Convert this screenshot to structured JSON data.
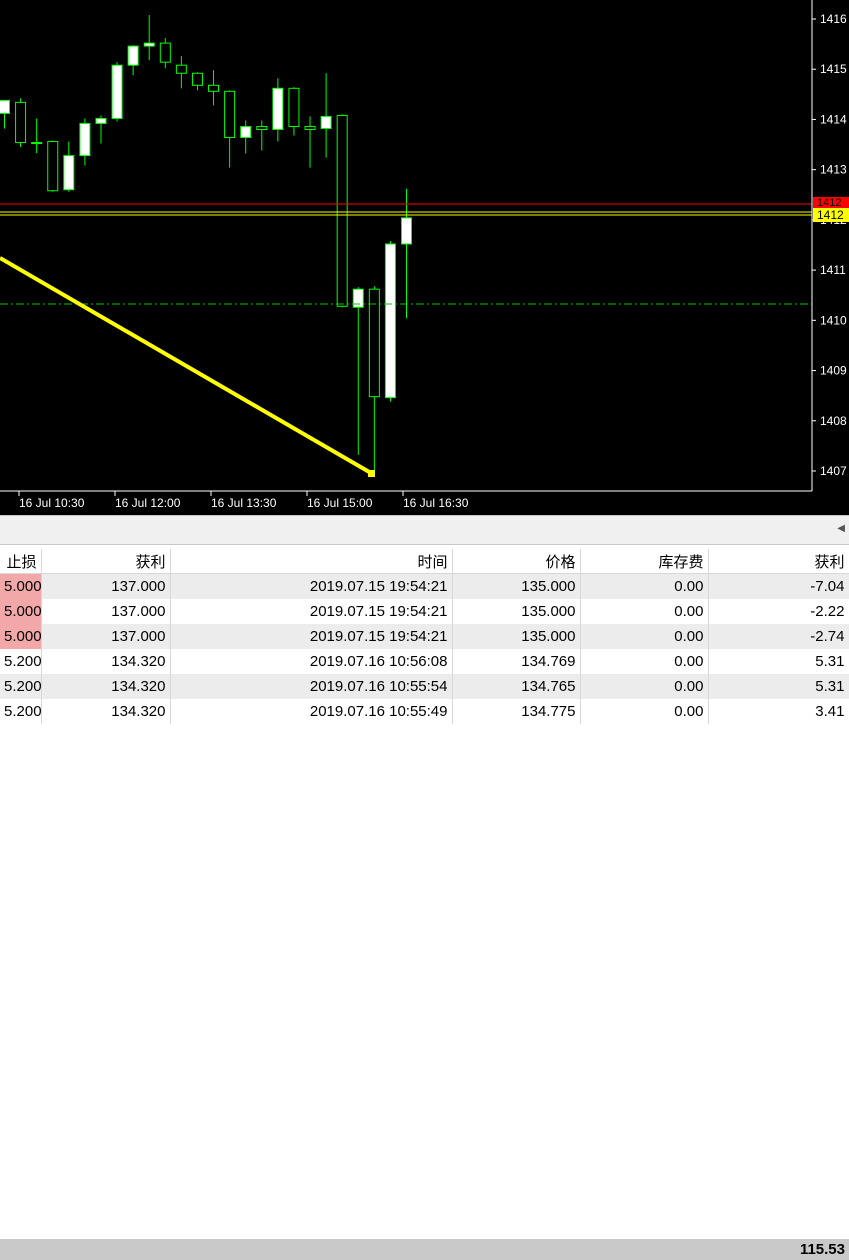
{
  "chart": {
    "price_labels": [
      "1416",
      "1415",
      "1414",
      "1413",
      "1412",
      "1411",
      "1410",
      "1409",
      "1408",
      "1407"
    ],
    "time_labels": [
      "16 Jul 10:30",
      "16 Jul 12:00",
      "16 Jul 13:30",
      "16 Jul 15:00",
      "16 Jul 16:30"
    ],
    "ask_label": "1412",
    "bid_label": "1412",
    "colors": {
      "background": "#000000",
      "candle": "#00ff00",
      "bull_body": "#ffffff",
      "bear_body": "#000000",
      "ask_line": "#ff0000",
      "bid_line": "#ffff00",
      "trend_line": "#ffff00",
      "level_line": "#00c800"
    },
    "candles": [
      {
        "o": 1414.12,
        "h": 1414.38,
        "l": 1413.82,
        "c": 1414.38
      },
      {
        "o": 1414.34,
        "h": 1414.42,
        "l": 1413.45,
        "c": 1413.54
      },
      {
        "o": 1413.54,
        "h": 1414.02,
        "l": 1413.33,
        "c": 1413.54
      },
      {
        "o": 1413.56,
        "h": 1413.58,
        "l": 1412.56,
        "c": 1412.58
      },
      {
        "o": 1412.6,
        "h": 1413.56,
        "l": 1412.56,
        "c": 1413.28
      },
      {
        "o": 1413.28,
        "h": 1414.02,
        "l": 1413.08,
        "c": 1413.92
      },
      {
        "o": 1413.92,
        "h": 1414.08,
        "l": 1413.52,
        "c": 1414.02
      },
      {
        "o": 1414.02,
        "h": 1415.14,
        "l": 1413.96,
        "c": 1415.08
      },
      {
        "o": 1415.08,
        "h": 1415.48,
        "l": 1414.88,
        "c": 1415.46
      },
      {
        "o": 1415.46,
        "h": 1416.08,
        "l": 1415.18,
        "c": 1415.52
      },
      {
        "o": 1415.52,
        "h": 1415.62,
        "l": 1415.02,
        "c": 1415.14
      },
      {
        "o": 1415.08,
        "h": 1415.26,
        "l": 1414.62,
        "c": 1414.92
      },
      {
        "o": 1414.92,
        "h": 1414.94,
        "l": 1414.58,
        "c": 1414.68
      },
      {
        "o": 1414.68,
        "h": 1414.98,
        "l": 1414.28,
        "c": 1414.56
      },
      {
        "o": 1414.56,
        "h": 1414.58,
        "l": 1413.04,
        "c": 1413.64
      },
      {
        "o": 1413.64,
        "h": 1413.98,
        "l": 1413.32,
        "c": 1413.86
      },
      {
        "o": 1413.86,
        "h": 1413.98,
        "l": 1413.38,
        "c": 1413.8
      },
      {
        "o": 1413.8,
        "h": 1414.82,
        "l": 1413.56,
        "c": 1414.62
      },
      {
        "o": 1414.62,
        "h": 1414.64,
        "l": 1413.68,
        "c": 1413.86
      },
      {
        "o": 1413.86,
        "h": 1414.06,
        "l": 1413.04,
        "c": 1413.8
      },
      {
        "o": 1413.82,
        "h": 1414.92,
        "l": 1413.24,
        "c": 1414.06
      },
      {
        "o": 1414.08,
        "h": 1414.1,
        "l": 1410.26,
        "c": 1410.28
      },
      {
        "o": 1410.26,
        "h": 1410.66,
        "l": 1407.32,
        "c": 1410.62
      },
      {
        "o": 1410.62,
        "h": 1410.68,
        "l": 1406.92,
        "c": 1408.48
      },
      {
        "o": 1408.46,
        "h": 1411.58,
        "l": 1408.38,
        "c": 1411.52
      },
      {
        "o": 1411.52,
        "h": 1412.62,
        "l": 1410.04,
        "c": 1412.04
      }
    ]
  },
  "orders_table": {
    "columns": [
      "止损",
      "获利",
      "时间",
      "价格",
      "库存费",
      "获利"
    ],
    "rows": [
      {
        "sl": "5.000",
        "tp": "137.000",
        "time": "2019.07.15 19:54:21",
        "price": "135.000",
        "swap": "0.00",
        "profit": "-7.04"
      },
      {
        "sl": "5.000",
        "tp": "137.000",
        "time": "2019.07.15 19:54:21",
        "price": "135.000",
        "swap": "0.00",
        "profit": "-2.22"
      },
      {
        "sl": "5.000",
        "tp": "137.000",
        "time": "2019.07.15 19:54:21",
        "price": "135.000",
        "swap": "0.00",
        "profit": "-2.74"
      },
      {
        "sl": "5.200",
        "tp": "134.320",
        "time": "2019.07.16 10:56:08",
        "price": "134.769",
        "swap": "0.00",
        "profit": "5.31"
      },
      {
        "sl": "5.200",
        "tp": "134.320",
        "time": "2019.07.16 10:55:54",
        "price": "134.765",
        "swap": "0.00",
        "profit": "5.31"
      },
      {
        "sl": "5.200",
        "tp": "134.320",
        "time": "2019.07.16 10:55:49",
        "price": "134.775",
        "swap": "0.00",
        "profit": "3.41"
      }
    ],
    "total": "115.53"
  }
}
